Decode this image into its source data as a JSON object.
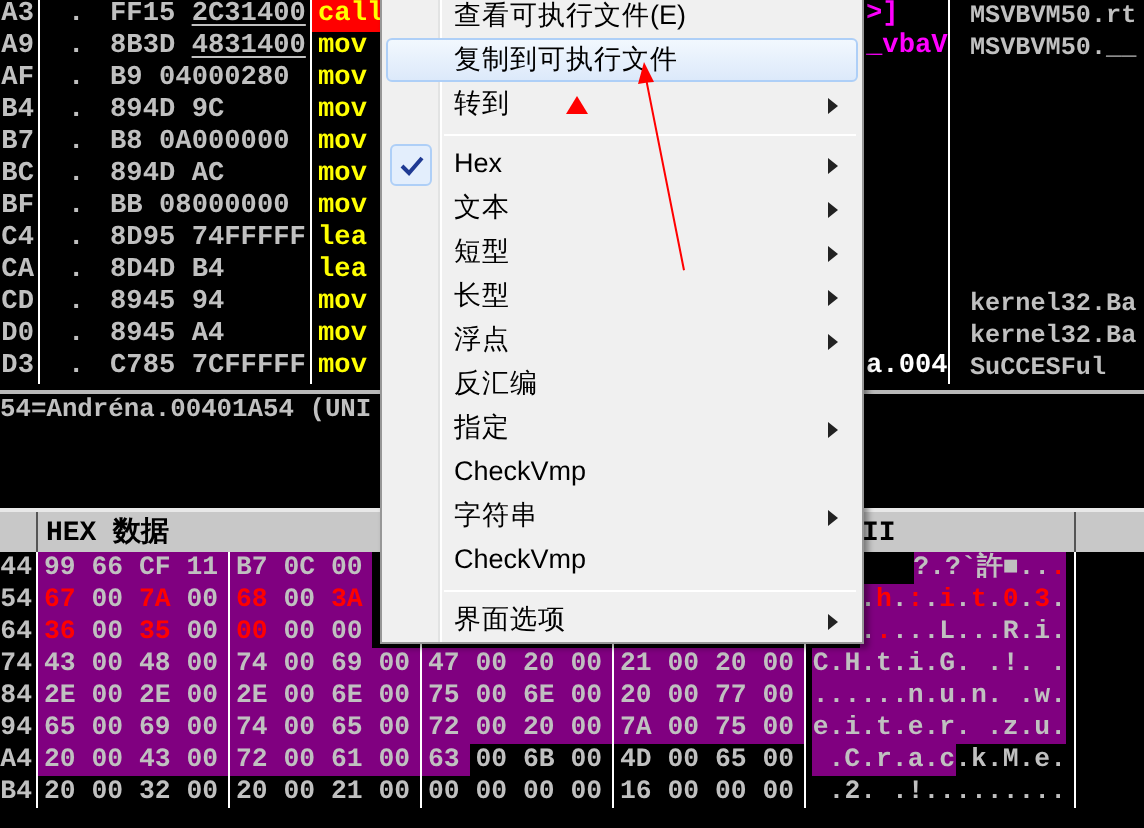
{
  "disassembly": {
    "rows": [
      {
        "address": "A3",
        "marker": ".",
        "bytes": "FF15",
        "operand": "2C31400",
        "underlined": true,
        "mnemonic": "call",
        "highlighted": true,
        "comment": {
          "text": ">]",
          "color": "#ff00ff"
        },
        "module": "MSVBVM50.rt"
      },
      {
        "address": "A9",
        "marker": ".",
        "bytes": "8B3D",
        "operand": "4831400",
        "underlined": true,
        "mnemonic": "mov",
        "highlighted": false,
        "comment": {
          "text": "_vbaV",
          "color": "#ff00ff"
        },
        "module": "MSVBVM50.__"
      },
      {
        "address": "AF",
        "marker": ".",
        "bytes": "B9",
        "operand": "04000280",
        "underlined": false,
        "mnemonic": "mov",
        "highlighted": false
      },
      {
        "address": "B4",
        "marker": ".",
        "bytes": "894D",
        "operand": "9C",
        "underlined": false,
        "mnemonic": "mov",
        "highlighted": false
      },
      {
        "address": "B7",
        "marker": ".",
        "bytes": "B8",
        "operand": "0A000000",
        "underlined": false,
        "mnemonic": "mov",
        "highlighted": false
      },
      {
        "address": "BC",
        "marker": ".",
        "bytes": "894D",
        "operand": "AC",
        "underlined": false,
        "mnemonic": "mov",
        "highlighted": false
      },
      {
        "address": "BF",
        "marker": ".",
        "bytes": "BB",
        "operand": "08000000",
        "underlined": false,
        "mnemonic": "mov",
        "highlighted": false
      },
      {
        "address": "C4",
        "marker": ".",
        "bytes": "8D95",
        "operand": "74FFFFF",
        "underlined": false,
        "mnemonic": "lea",
        "highlighted": false
      },
      {
        "address": "CA",
        "marker": ".",
        "bytes": "8D4D",
        "operand": "B4",
        "underlined": false,
        "mnemonic": "lea",
        "highlighted": false
      },
      {
        "address": "CD",
        "marker": ".",
        "bytes": "8945",
        "operand": "94",
        "underlined": false,
        "mnemonic": "mov",
        "highlighted": false,
        "module": "kernel32.Ba"
      },
      {
        "address": "D0",
        "marker": ".",
        "bytes": "8945",
        "operand": "A4",
        "underlined": false,
        "mnemonic": "mov",
        "highlighted": false,
        "module": "kernel32.Ba"
      },
      {
        "address": "D3",
        "marker": ".",
        "bytes": "C785",
        "operand": "7CFFFFF",
        "underlined": false,
        "mnemonic": "mov",
        "highlighted": false,
        "comment": {
          "text": "a.004",
          "color": "#ffffff"
        },
        "module": "SuCCESFul"
      }
    ]
  },
  "info": {
    "text": "54=Andréna.00401A54 (UNI"
  },
  "dump": {
    "header": {
      "title": "HEX 数据",
      "ascii_title": "II"
    },
    "rows": [
      {
        "address": "44",
        "bytes": [
          {
            "value": "99",
            "selected": true,
            "changed": false
          },
          {
            "value": "66",
            "selected": true,
            "changed": false
          },
          {
            "value": "CF",
            "selected": true,
            "changed": false
          },
          {
            "value": "11",
            "selected": true,
            "changed": false
          },
          {
            "value": "B7",
            "selected": true,
            "changed": false
          },
          {
            "value": "0C",
            "selected": true,
            "changed": false
          },
          {
            "value": "00",
            "selected": true,
            "changed": false
          }
        ],
        "ascii": [
          {
            "text": "?.?`許■..",
            "selected": true,
            "changed": false
          },
          {
            "text": ".",
            "selected": true,
            "changed": true
          }
        ]
      },
      {
        "address": "54",
        "bytes": [
          {
            "value": "67",
            "selected": true,
            "changed": true
          },
          {
            "value": "00",
            "selected": true,
            "changed": false
          },
          {
            "value": "7A",
            "selected": true,
            "changed": true
          },
          {
            "value": "00",
            "selected": true,
            "changed": false
          },
          {
            "value": "68",
            "selected": true,
            "changed": true
          },
          {
            "value": "00",
            "selected": true,
            "changed": false
          },
          {
            "value": "3A",
            "selected": true,
            "changed": true
          }
        ],
        "ascii": [
          {
            "text": ".",
            "selected": true,
            "changed": false
          },
          {
            "text": "h",
            "selected": true,
            "changed": true
          },
          {
            "text": ".",
            "selected": true,
            "changed": false
          },
          {
            "text": ":",
            "selected": true,
            "changed": true
          },
          {
            "text": ".",
            "selected": true,
            "changed": false
          },
          {
            "text": "i",
            "selected": true,
            "changed": true
          },
          {
            "text": ".",
            "selected": true,
            "changed": false
          },
          {
            "text": "t",
            "selected": true,
            "changed": true
          },
          {
            "text": ".",
            "selected": true,
            "changed": false
          },
          {
            "text": "0",
            "selected": true,
            "changed": true
          },
          {
            "text": ".",
            "selected": true,
            "changed": false
          },
          {
            "text": "3",
            "selected": true,
            "changed": true
          },
          {
            "text": ".",
            "selected": true,
            "changed": false
          }
        ]
      },
      {
        "address": "64",
        "bytes": [
          {
            "value": "36",
            "selected": true,
            "changed": true
          },
          {
            "value": "00",
            "selected": true,
            "changed": false
          },
          {
            "value": "35",
            "selected": true,
            "changed": true
          },
          {
            "value": "00",
            "selected": true,
            "changed": false
          },
          {
            "value": "00",
            "selected": true,
            "changed": true
          },
          {
            "value": "00",
            "selected": true,
            "changed": false
          },
          {
            "value": "00",
            "selected": true,
            "changed": false
          }
        ],
        "ascii": [
          {
            "text": ".",
            "selected": true,
            "changed": false
          },
          {
            "text": ".",
            "selected": true,
            "changed": true
          },
          {
            "text": "...L...R.i.",
            "selected": true,
            "changed": false
          }
        ]
      },
      {
        "address": "74",
        "bytes": [
          {
            "value": "43",
            "selected": true,
            "changed": false
          },
          {
            "value": "00",
            "selected": true,
            "changed": false
          },
          {
            "value": "48",
            "selected": true,
            "changed": false
          },
          {
            "value": "00",
            "selected": true,
            "changed": false
          },
          {
            "value": "74",
            "selected": true,
            "changed": false
          },
          {
            "value": "00",
            "selected": true,
            "changed": false
          },
          {
            "value": "69",
            "selected": true,
            "changed": false
          },
          {
            "value": "00",
            "selected": true,
            "changed": false
          },
          {
            "value": "47",
            "selected": true,
            "changed": false
          },
          {
            "value": "00",
            "selected": true,
            "changed": false
          },
          {
            "value": "20",
            "selected": true,
            "changed": false
          },
          {
            "value": "00",
            "selected": true,
            "changed": false
          },
          {
            "value": "21",
            "selected": true,
            "changed": false
          },
          {
            "value": "00",
            "selected": true,
            "changed": false
          },
          {
            "value": "20",
            "selected": true,
            "changed": false
          },
          {
            "value": "00",
            "selected": true,
            "changed": false
          }
        ],
        "ascii": [
          {
            "text": "C.H.t.i.G. .!. .",
            "selected": true,
            "changed": false
          }
        ]
      },
      {
        "address": "84",
        "bytes": [
          {
            "value": "2E",
            "selected": true,
            "changed": false
          },
          {
            "value": "00",
            "selected": true,
            "changed": false
          },
          {
            "value": "2E",
            "selected": true,
            "changed": false
          },
          {
            "value": "00",
            "selected": true,
            "changed": false
          },
          {
            "value": "2E",
            "selected": true,
            "changed": false
          },
          {
            "value": "00",
            "selected": true,
            "changed": false
          },
          {
            "value": "6E",
            "selected": true,
            "changed": false
          },
          {
            "value": "00",
            "selected": true,
            "changed": false
          },
          {
            "value": "75",
            "selected": true,
            "changed": false
          },
          {
            "value": "00",
            "selected": true,
            "changed": false
          },
          {
            "value": "6E",
            "selected": true,
            "changed": false
          },
          {
            "value": "00",
            "selected": true,
            "changed": false
          },
          {
            "value": "20",
            "selected": true,
            "changed": false
          },
          {
            "value": "00",
            "selected": true,
            "changed": false
          },
          {
            "value": "77",
            "selected": true,
            "changed": false
          },
          {
            "value": "00",
            "selected": true,
            "changed": false
          }
        ],
        "ascii": [
          {
            "text": "......n.u.n. .w.",
            "selected": true,
            "changed": false
          }
        ]
      },
      {
        "address": "94",
        "bytes": [
          {
            "value": "65",
            "selected": true,
            "changed": false
          },
          {
            "value": "00",
            "selected": true,
            "changed": false
          },
          {
            "value": "69",
            "selected": true,
            "changed": false
          },
          {
            "value": "00",
            "selected": true,
            "changed": false
          },
          {
            "value": "74",
            "selected": true,
            "changed": false
          },
          {
            "value": "00",
            "selected": true,
            "changed": false
          },
          {
            "value": "65",
            "selected": true,
            "changed": false
          },
          {
            "value": "00",
            "selected": true,
            "changed": false
          },
          {
            "value": "72",
            "selected": true,
            "changed": false
          },
          {
            "value": "00",
            "selected": true,
            "changed": false
          },
          {
            "value": "20",
            "selected": true,
            "changed": false
          },
          {
            "value": "00",
            "selected": true,
            "changed": false
          },
          {
            "value": "7A",
            "selected": true,
            "changed": false
          },
          {
            "value": "00",
            "selected": true,
            "changed": false
          },
          {
            "value": "75",
            "selected": true,
            "changed": false
          },
          {
            "value": "00",
            "selected": true,
            "changed": false
          }
        ],
        "ascii": [
          {
            "text": "e.i.t.e.r. .z.u.",
            "selected": true,
            "changed": false
          }
        ]
      },
      {
        "address": "A4",
        "bytes": [
          {
            "value": "20",
            "selected": true,
            "changed": false
          },
          {
            "value": "00",
            "selected": true,
            "changed": false
          },
          {
            "value": "43",
            "selected": true,
            "changed": false
          },
          {
            "value": "00",
            "selected": true,
            "changed": false
          },
          {
            "value": "72",
            "selected": true,
            "changed": false
          },
          {
            "value": "00",
            "selected": true,
            "changed": false
          },
          {
            "value": "61",
            "selected": true,
            "changed": false
          },
          {
            "value": "00",
            "selected": true,
            "changed": false
          },
          {
            "value": "63",
            "selected": true,
            "changed": false
          },
          {
            "value": "00",
            "selected": false,
            "changed": false
          },
          {
            "value": "6B",
            "selected": false,
            "changed": false
          },
          {
            "value": "00",
            "selected": false,
            "changed": false
          },
          {
            "value": "4D",
            "selected": false,
            "changed": false
          },
          {
            "value": "00",
            "selected": false,
            "changed": false
          },
          {
            "value": "65",
            "selected": false,
            "changed": false
          },
          {
            "value": "00",
            "selected": false,
            "changed": false
          }
        ],
        "ascii": [
          {
            "text": " .C.r.a.c",
            "selected": true,
            "changed": false
          },
          {
            "text": ".k.M.e.",
            "selected": false,
            "changed": false
          }
        ]
      },
      {
        "address": "B4",
        "bytes": [
          {
            "value": "20",
            "selected": false,
            "changed": false
          },
          {
            "value": "00",
            "selected": false,
            "changed": false
          },
          {
            "value": "32",
            "selected": false,
            "changed": false
          },
          {
            "value": "00",
            "selected": false,
            "changed": false
          },
          {
            "value": "20",
            "selected": false,
            "changed": false
          },
          {
            "value": "00",
            "selected": false,
            "changed": false
          },
          {
            "value": "21",
            "selected": false,
            "changed": false
          },
          {
            "value": "00",
            "selected": false,
            "changed": false
          },
          {
            "value": "00",
            "selected": false,
            "changed": false
          },
          {
            "value": "00",
            "selected": false,
            "changed": false
          },
          {
            "value": "00",
            "selected": false,
            "changed": false
          },
          {
            "value": "00",
            "selected": false,
            "changed": false
          },
          {
            "value": "16",
            "selected": false,
            "changed": false
          },
          {
            "value": "00",
            "selected": false,
            "changed": false
          },
          {
            "value": "00",
            "selected": false,
            "changed": false
          },
          {
            "value": "00",
            "selected": false,
            "changed": false
          }
        ],
        "ascii": [
          {
            "text": " .2. .!.........",
            "selected": false,
            "changed": false
          }
        ]
      }
    ]
  },
  "context_menu": {
    "items": [
      {
        "kind": "item",
        "label": "查看可执行文件(E)",
        "selected": false,
        "checked": false,
        "submenu": false
      },
      {
        "kind": "item",
        "label": "复制到可执行文件",
        "selected": true,
        "checked": false,
        "submenu": false
      },
      {
        "kind": "item",
        "label": "转到",
        "selected": false,
        "checked": false,
        "submenu": true
      },
      {
        "kind": "separator"
      },
      {
        "kind": "item",
        "label": "Hex",
        "selected": false,
        "checked": true,
        "submenu": true
      },
      {
        "kind": "item",
        "label": "文本",
        "selected": false,
        "checked": false,
        "submenu": true
      },
      {
        "kind": "item",
        "label": "短型",
        "selected": false,
        "checked": false,
        "submenu": true
      },
      {
        "kind": "item",
        "label": "长型",
        "selected": false,
        "checked": false,
        "submenu": true
      },
      {
        "kind": "item",
        "label": "浮点",
        "selected": false,
        "checked": false,
        "submenu": true
      },
      {
        "kind": "item",
        "label": "反汇编",
        "selected": false,
        "checked": false,
        "submenu": false
      },
      {
        "kind": "item",
        "label": "指定",
        "selected": false,
        "checked": false,
        "submenu": true
      },
      {
        "kind": "item",
        "label": "CheckVmp",
        "selected": false,
        "checked": false,
        "submenu": false
      },
      {
        "kind": "item",
        "label": "字符串",
        "selected": false,
        "checked": false,
        "submenu": true
      },
      {
        "kind": "item",
        "label": "CheckVmp",
        "selected": false,
        "checked": false,
        "submenu": false
      },
      {
        "kind": "separator"
      },
      {
        "kind": "item",
        "label": "界面选项",
        "selected": false,
        "checked": false,
        "submenu": true
      }
    ]
  }
}
